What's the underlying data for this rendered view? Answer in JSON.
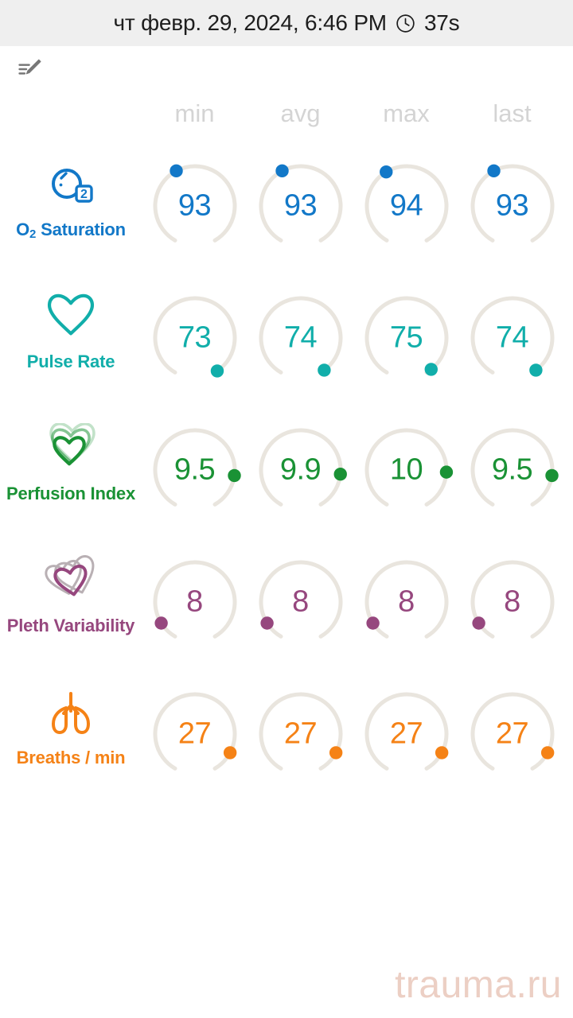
{
  "title_bar": {
    "datetime": "чт февр. 29, 2024, 6:46 PM",
    "clock_icon": "clock-icon",
    "duration": "37s",
    "background": "#efefef"
  },
  "toolbar": {
    "edit_note_icon": "edit-note-icon",
    "icon_color": "#777777"
  },
  "table": {
    "columns": [
      "min",
      "avg",
      "max",
      "last"
    ],
    "column_header_color": "#d4d4d4",
    "gauge_track_color": "#e9e5de"
  },
  "metrics": [
    {
      "name": "O₂ Saturation",
      "name_prefix": "O",
      "name_sub": "2",
      "name_suffix": " Saturation",
      "icon": "oxygen-molecule-icon",
      "color": "#1278c8",
      "values": [
        "93",
        "93",
        "94",
        "93"
      ],
      "dot_angles": [
        118,
        118,
        121,
        118
      ]
    },
    {
      "name": "Pulse Rate",
      "icon": "heart-outline-icon",
      "color": "#11aeaa",
      "values": [
        "73",
        "74",
        "75",
        "74"
      ],
      "dot_angles": [
        -56,
        -54,
        -52,
        -54
      ]
    },
    {
      "name": "Perfusion Index",
      "icon": "nested-hearts-icon",
      "color": "#1a9235",
      "values": [
        "9.5",
        "9.9",
        "10",
        "9.5"
      ],
      "dot_angles": [
        -8,
        -6,
        -3,
        -8
      ]
    },
    {
      "name": "Pleth Variability",
      "icon": "overlapping-hearts-icon",
      "color": "#96477e",
      "values": [
        "8",
        "8",
        "8",
        "8"
      ],
      "dot_angles": [
        -148,
        -148,
        -148,
        -148
      ]
    },
    {
      "name": "Breaths / min",
      "icon": "lungs-icon",
      "color": "#f58216",
      "values": [
        "27",
        "27",
        "27",
        "27"
      ],
      "dot_angles": [
        -28,
        -28,
        -28,
        -28
      ]
    }
  ],
  "watermark": {
    "text": "trauma.ru",
    "color": "#eccfc4"
  }
}
